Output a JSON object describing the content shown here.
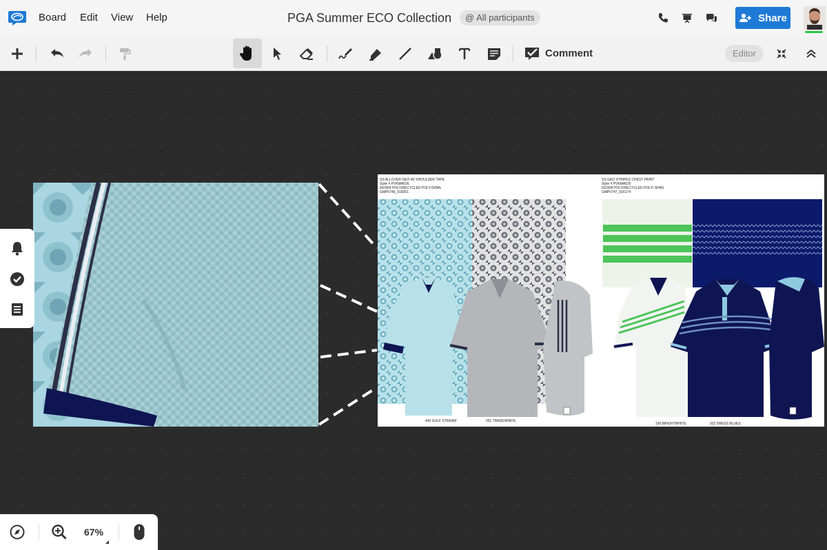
{
  "app": {
    "title": "PGA Summer ECO Collection",
    "participants_label": "@ All participants"
  },
  "menu": [
    "Board",
    "Edit",
    "View",
    "Help"
  ],
  "header_actions": {
    "share_label": "Share",
    "icons": [
      "phone-icon",
      "present-icon",
      "chat-icon"
    ]
  },
  "toolbar": {
    "tools": [
      "add",
      "undo",
      "redo",
      "format-painter",
      "hand",
      "select",
      "eraser",
      "pen",
      "marker",
      "line",
      "shapes",
      "text",
      "sticky-note",
      "comment"
    ],
    "active_tool": "hand",
    "comment_label": "Comment",
    "mode_label": "Editor"
  },
  "board": {
    "left_sheet": {
      "header": [
        "SS ALLOVER GEO W/ SHOULDER TAPE",
        "Style # PVKMA026",
        "66/30/4 POLY/RECYCLED POLY/SPAN",
        "GMP0745_918351"
      ],
      "colorways": [
        "443 GULF STREAM",
        "031 TRADEWINDS"
      ]
    },
    "right_sheet": {
      "header": [
        "SS GEO STRIPES CHEST PRINT",
        "Style # PVKMA025",
        "62/30/8 POLY/RECYCLED POLY/ SPAN",
        "GMP0747_916174"
      ],
      "colorways": [
        "100 BRIGHTWHITE",
        "922 DRESS BLUES"
      ]
    }
  },
  "side_panel": [
    "bell-icon",
    "check-circle-icon",
    "list-icon"
  ],
  "zoom": {
    "value": "67%"
  },
  "colors": {
    "accent": "#1e7ad6",
    "canvas": "#2b2b2b",
    "navy": "#0f1552",
    "aqua": "#a9d6e0",
    "grey_shirt": "#b5b6ba",
    "green": "#4cc458"
  }
}
